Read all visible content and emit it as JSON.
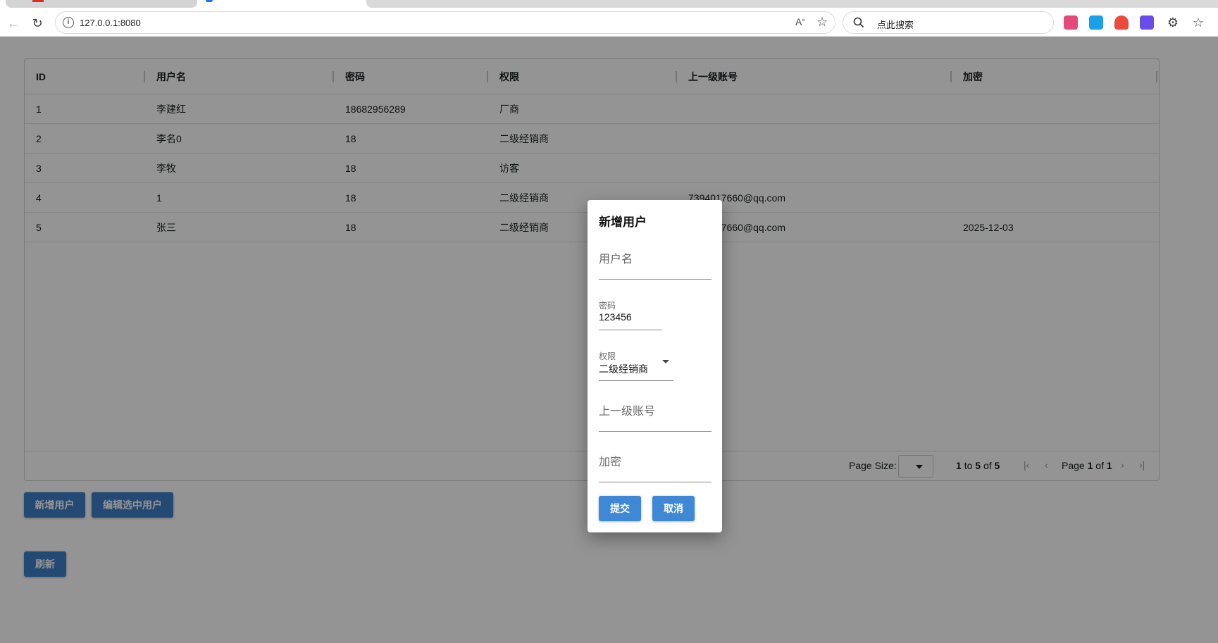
{
  "browser": {
    "url": "127.0.0.1:8080",
    "search_placeholder": "点此搜索"
  },
  "grid": {
    "columns": [
      "ID",
      "用户名",
      "密码",
      "权限",
      "上一级账号",
      "加密"
    ],
    "rows": [
      {
        "id": "1",
        "username": "李建红",
        "password": "18682956289",
        "role": "厂商",
        "parent": "",
        "encrypt": ""
      },
      {
        "id": "2",
        "username": "李名0",
        "password": "18",
        "role": "二级经销商",
        "parent": "",
        "encrypt": ""
      },
      {
        "id": "3",
        "username": "李牧",
        "password": "18",
        "role": "访客",
        "parent": "",
        "encrypt": ""
      },
      {
        "id": "4",
        "username": "1",
        "password": "18",
        "role": "二级经销商",
        "parent": "7394017660@qq.com",
        "encrypt": ""
      },
      {
        "id": "5",
        "username": "张三",
        "password": "18",
        "role": "二级经销商",
        "parent": "7394017660@qq.com",
        "encrypt": "2025-12-03"
      }
    ],
    "footer": {
      "page_size_label": "Page Size:",
      "summary_from": "1",
      "summary_to_word": "to",
      "summary_to": "5",
      "summary_of_word": "of",
      "summary_total": "5",
      "page_word": "Page",
      "page_current": "1",
      "page_of_word": "of",
      "page_total": "1"
    }
  },
  "actions": {
    "add_user": "新增用户",
    "edit_selected": "编辑选中用户",
    "refresh": "刷新"
  },
  "dialog": {
    "title": "新增用户",
    "username_placeholder": "用户名",
    "password_label": "密码",
    "password_value": "123456",
    "role_label": "权限",
    "role_value": "二级经销商",
    "parent_placeholder": "上一级账号",
    "encrypt_placeholder": "加密",
    "submit": "提交",
    "cancel": "取消"
  },
  "colors": {
    "primary_button": "#3f88d6",
    "overlay": "rgba(0,0,0,0.42)"
  }
}
